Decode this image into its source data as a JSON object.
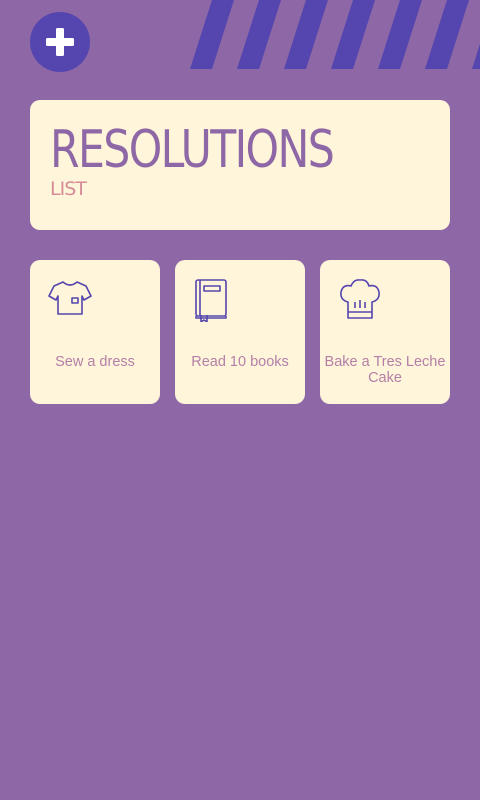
{
  "header": {
    "title": "RESOLUTIONS",
    "subtitle": "LIST"
  },
  "resolutions": [
    {
      "label": "Sew a dress",
      "icon": "shirt-icon"
    },
    {
      "label": "Read 10 books",
      "icon": "book-icon"
    },
    {
      "label": "Bake a Tres Leche Cake",
      "icon": "chef-hat-icon"
    }
  ],
  "colors": {
    "background": "#8e67a6",
    "accent": "#5446ae",
    "card": "#fff5da",
    "title": "#8e67a6",
    "subtitle": "#d68c97",
    "label": "#b57fa8"
  },
  "icons": {
    "add": "plus-icon"
  }
}
